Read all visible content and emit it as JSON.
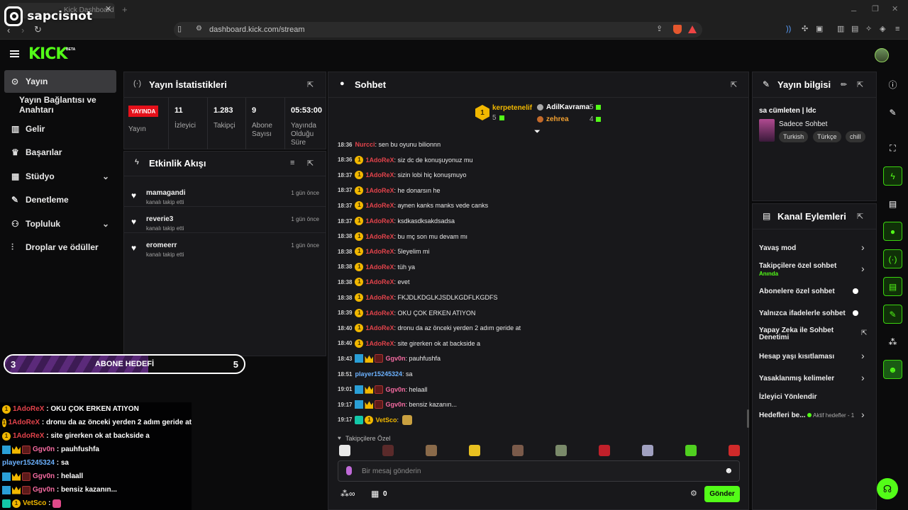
{
  "browser": {
    "tab_title": "Kick Dashboard",
    "url": "dashboard.kick.com/stream"
  },
  "watermark": {
    "handle": "sapcisnot"
  },
  "app": {
    "logo": "KICK",
    "beta": "BETA"
  },
  "sidebar": {
    "items": [
      {
        "label": "Yayın",
        "icon": "broadcast-icon"
      },
      {
        "label": "Yayın Bağlantısı ve Anahtarı"
      },
      {
        "label": "Gelir",
        "icon": "chart-icon"
      },
      {
        "label": "Başarılar",
        "icon": "trophy-icon"
      },
      {
        "label": "Stüdyo",
        "icon": "grid-icon"
      },
      {
        "label": "Denetleme",
        "icon": "wrench-icon"
      },
      {
        "label": "Topluluk",
        "icon": "people-icon"
      },
      {
        "label": "Droplar ve ödüller",
        "icon": "drops-icon"
      }
    ]
  },
  "stats": {
    "title": "Yayın İstatistikleri",
    "live_badge": "YAYINDA",
    "live_label": "Yayın",
    "items": [
      {
        "value": "11",
        "label": "İzleyici"
      },
      {
        "value": "1.283",
        "label": "Takipçi"
      },
      {
        "value": "9",
        "label": "Abone Sayısı"
      },
      {
        "value": "05:53:00",
        "label": "Yayında Olduğu Süre"
      }
    ]
  },
  "activity": {
    "title": "Etkinlik Akışı",
    "items": [
      {
        "name": "mamagandi",
        "sub": "kanalı takip etti",
        "time": "1 gün önce"
      },
      {
        "name": "reverie3",
        "sub": "kanalı takip etti",
        "time": "1 gün önce"
      },
      {
        "name": "eromeerr",
        "sub": "kanalı takip etti",
        "time": "1 gün önce"
      }
    ]
  },
  "goal": {
    "current": "3",
    "title": "ABONE HEDEFİ",
    "target": "5",
    "progress": 0.6
  },
  "overlay_chat": [
    {
      "user": "1AdoReX",
      "text": "OKU ÇOK ERKEN ATIYON",
      "color": "#e2434b",
      "badges": "one"
    },
    {
      "user": "1AdoReX",
      "text": "dronu da az önceki yerden 2 adım geride at",
      "color": "#e2434b",
      "badges": "one"
    },
    {
      "user": "1AdoReX",
      "text": "site girerken ok at backside a",
      "color": "#e2434b",
      "badges": "one"
    },
    {
      "user": "Ggv0n",
      "text": "pauhfushfa",
      "color": "#f46aa0",
      "badges": "sub"
    },
    {
      "user": "player15245324",
      "text": "sa",
      "color": "#6cb2ff",
      "badges": "none"
    },
    {
      "user": "Ggv0n",
      "text": "helaall",
      "color": "#f46aa0",
      "badges": "sub"
    },
    {
      "user": "Ggv0n",
      "text": "bensiz kazanın...",
      "color": "#f46aa0",
      "badges": "sub"
    },
    {
      "user": "VetSco",
      "text": "",
      "color": "#f2b800",
      "badges": "og"
    }
  ],
  "chat": {
    "title": "Sohbet",
    "leaderboard": [
      {
        "rank": "1",
        "name": "kerpetenelif",
        "count": "5"
      },
      {
        "name": "AdilKavrama",
        "count": "5"
      },
      {
        "name": "zehrea",
        "count": "4"
      }
    ],
    "messages": [
      {
        "time": "18:36",
        "user": "Nurcci",
        "text": "sen bu oyunu bilionnn",
        "color": "#e2434b",
        "badges": "none"
      },
      {
        "time": "18:36",
        "user": "1AdoReX",
        "text": "siz dc de konuşuyonuz mu",
        "color": "#e2434b",
        "badges": "one"
      },
      {
        "time": "18:37",
        "user": "1AdoReX",
        "text": "sizin lobi hiç konuşmuyo",
        "color": "#e2434b",
        "badges": "one"
      },
      {
        "time": "18:37",
        "user": "1AdoReX",
        "text": "he donarsın he",
        "color": "#e2434b",
        "badges": "one"
      },
      {
        "time": "18:37",
        "user": "1AdoReX",
        "text": "aynen kanks manks vede canks",
        "color": "#e2434b",
        "badges": "one"
      },
      {
        "time": "18:37",
        "user": "1AdoReX",
        "text": "ksdkasdksakdsadsa",
        "color": "#e2434b",
        "badges": "one"
      },
      {
        "time": "18:38",
        "user": "1AdoReX",
        "text": "bu mç son mu devam mı",
        "color": "#e2434b",
        "badges": "one"
      },
      {
        "time": "18:38",
        "user": "1AdoReX",
        "text": "5leyelim mi",
        "color": "#e2434b",
        "badges": "one"
      },
      {
        "time": "18:38",
        "user": "1AdoReX",
        "text": "tüh ya",
        "color": "#e2434b",
        "badges": "one"
      },
      {
        "time": "18:38",
        "user": "1AdoReX",
        "text": "evet",
        "color": "#e2434b",
        "badges": "one"
      },
      {
        "time": "18:38",
        "user": "1AdoReX",
        "text": "FKJDLKDGLKJSDLKGDFLKGDFS",
        "color": "#e2434b",
        "badges": "one"
      },
      {
        "time": "18:39",
        "user": "1AdoReX",
        "text": "OKU ÇOK ERKEN ATIYON",
        "color": "#e2434b",
        "badges": "one"
      },
      {
        "time": "18:40",
        "user": "1AdoReX",
        "text": "dronu da az önceki yerden 2 adım geride at",
        "color": "#e2434b",
        "badges": "one"
      },
      {
        "time": "18:40",
        "user": "1AdoReX",
        "text": "site girerken ok at backside a",
        "color": "#e2434b",
        "badges": "one"
      },
      {
        "time": "18:43",
        "user": "Ggv0n",
        "text": "pauhfushfa",
        "color": "#f46aa0",
        "badges": "sub"
      },
      {
        "time": "18:51",
        "user": "player15245324",
        "text": "sa",
        "color": "#6cb2ff",
        "badges": "none"
      },
      {
        "time": "19:01",
        "user": "Ggv0n",
        "text": "helaall",
        "color": "#f46aa0",
        "badges": "sub"
      },
      {
        "time": "19:17",
        "user": "Ggv0n",
        "text": "bensiz kazanın...",
        "color": "#f46aa0",
        "badges": "sub"
      },
      {
        "time": "19:17",
        "user": "VetSco",
        "text": "",
        "color": "#f2b800",
        "badges": "og"
      }
    ],
    "emote_section_label": "Takipçilere Özel",
    "emote_colors": [
      "#e8e8e8",
      "#5a2a2a",
      "#8a6a4a",
      "#e8c020",
      "#7a5a4a",
      "#7a8a6a",
      "#c0202a",
      "#a0a0c0",
      "#50d020",
      "#d02a2a"
    ],
    "input_placeholder": "Bir mesaj gönderin",
    "points_value": "0",
    "send_label": "Gönder"
  },
  "stream_info": {
    "title": "Yayın bilgisi",
    "stream_title": "sa cümleten | ldc",
    "category": "Sadece Sohbet",
    "tags": [
      "Turkish",
      "Türkçe",
      "chill"
    ]
  },
  "channel_actions": {
    "title": "Kanal Eylemleri",
    "items": [
      {
        "label": "Yavaş mod",
        "control": "arrow"
      },
      {
        "label": "Takipçilere özel sohbet",
        "sub": "Anında",
        "control": "arrow"
      },
      {
        "label": "Abonelere özel sohbet",
        "control": "toggle"
      },
      {
        "label": "Yalnızca ifadelerle sohbet",
        "control": "toggle"
      },
      {
        "label": "Yapay Zeka ile Sohbet Denetimi",
        "control": "external"
      },
      {
        "label": "Hesap yaşı kısıtlaması",
        "control": "arrow"
      },
      {
        "label": "Yasaklanmış kelimeler",
        "control": "arrow"
      },
      {
        "label": "İzleyici Yönlendir",
        "control": "none"
      },
      {
        "label": "Hedefleri be...",
        "badge": "Aktif hedefler - 1",
        "control": "arrow"
      }
    ]
  },
  "colors": {
    "brand": "#53fc18",
    "live": "#e5101a",
    "panel": "#18181b"
  }
}
